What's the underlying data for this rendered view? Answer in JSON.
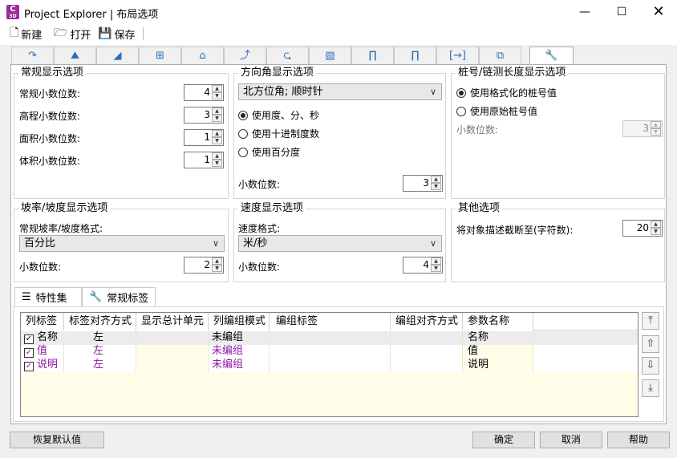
{
  "window": {
    "title": "Project Explorer | 布局选项",
    "icon_letter": "C",
    "icon_sub": "3D"
  },
  "toolbar": {
    "new_label": "新建",
    "open_label": "打开",
    "save_label": "保存"
  },
  "tabs": [
    "arrow-icon",
    "road-icon",
    "road-curve-icon",
    "section-icon",
    "surface-icon",
    "curve-icon",
    "intersection-icon",
    "map-icon",
    "pier-icon",
    "pier2-icon",
    "bracket-icon",
    "vehicle-icon",
    "wrench-icon"
  ],
  "general": {
    "title": "常规显示选项",
    "rows": [
      {
        "label": "常规小数位数:",
        "value": "4"
      },
      {
        "label": "高程小数位数:",
        "value": "3"
      },
      {
        "label": "面积小数位数:",
        "value": "1"
      },
      {
        "label": "体积小数位数:",
        "value": "1"
      }
    ]
  },
  "bearing": {
    "title": "方向角显示选项",
    "combo": "北方位角; 顺时针",
    "options": [
      "使用度、分、秒",
      "使用十进制度数",
      "使用百分度"
    ],
    "decimals_label": "小数位数:",
    "decimals": "3"
  },
  "station": {
    "title": "桩号/链测长度显示选项",
    "options": [
      "使用格式化的桩号值",
      "使用原始桩号值"
    ],
    "decimals_label": "小数位数:",
    "decimals": "3"
  },
  "slope": {
    "title": "坡率/坡度显示选项",
    "format_label": "常规坡率/坡度格式:",
    "combo": "百分比",
    "decimals_label": "小数位数:",
    "decimals": "2"
  },
  "speed": {
    "title": "速度显示选项",
    "format_label": "速度格式:",
    "combo": "米/秒",
    "decimals_label": "小数位数:",
    "decimals": "4"
  },
  "other": {
    "title": "其他选项",
    "truncate_label": "将对象描述截断至(字符数):",
    "truncate_value": "20"
  },
  "bottom_tabs": {
    "properties": "特性集",
    "labels": "常规标签"
  },
  "grid": {
    "headers": [
      "列标签",
      "标签对齐方式",
      "显示总计单元",
      "列编组模式",
      "编组标签",
      "编组对齐方式",
      "参数名称"
    ],
    "rows": [
      {
        "label": "名称",
        "align": "左",
        "group_mode": "未编组",
        "param": "名称"
      },
      {
        "label": "值",
        "align": "左",
        "group_mode": "未编组",
        "param": "值"
      },
      {
        "label": "说明",
        "align": "左",
        "group_mode": "未编组",
        "param": "说明"
      }
    ]
  },
  "buttons": {
    "reset": "恢复默认值",
    "ok": "确定",
    "cancel": "取消",
    "help": "帮助"
  }
}
